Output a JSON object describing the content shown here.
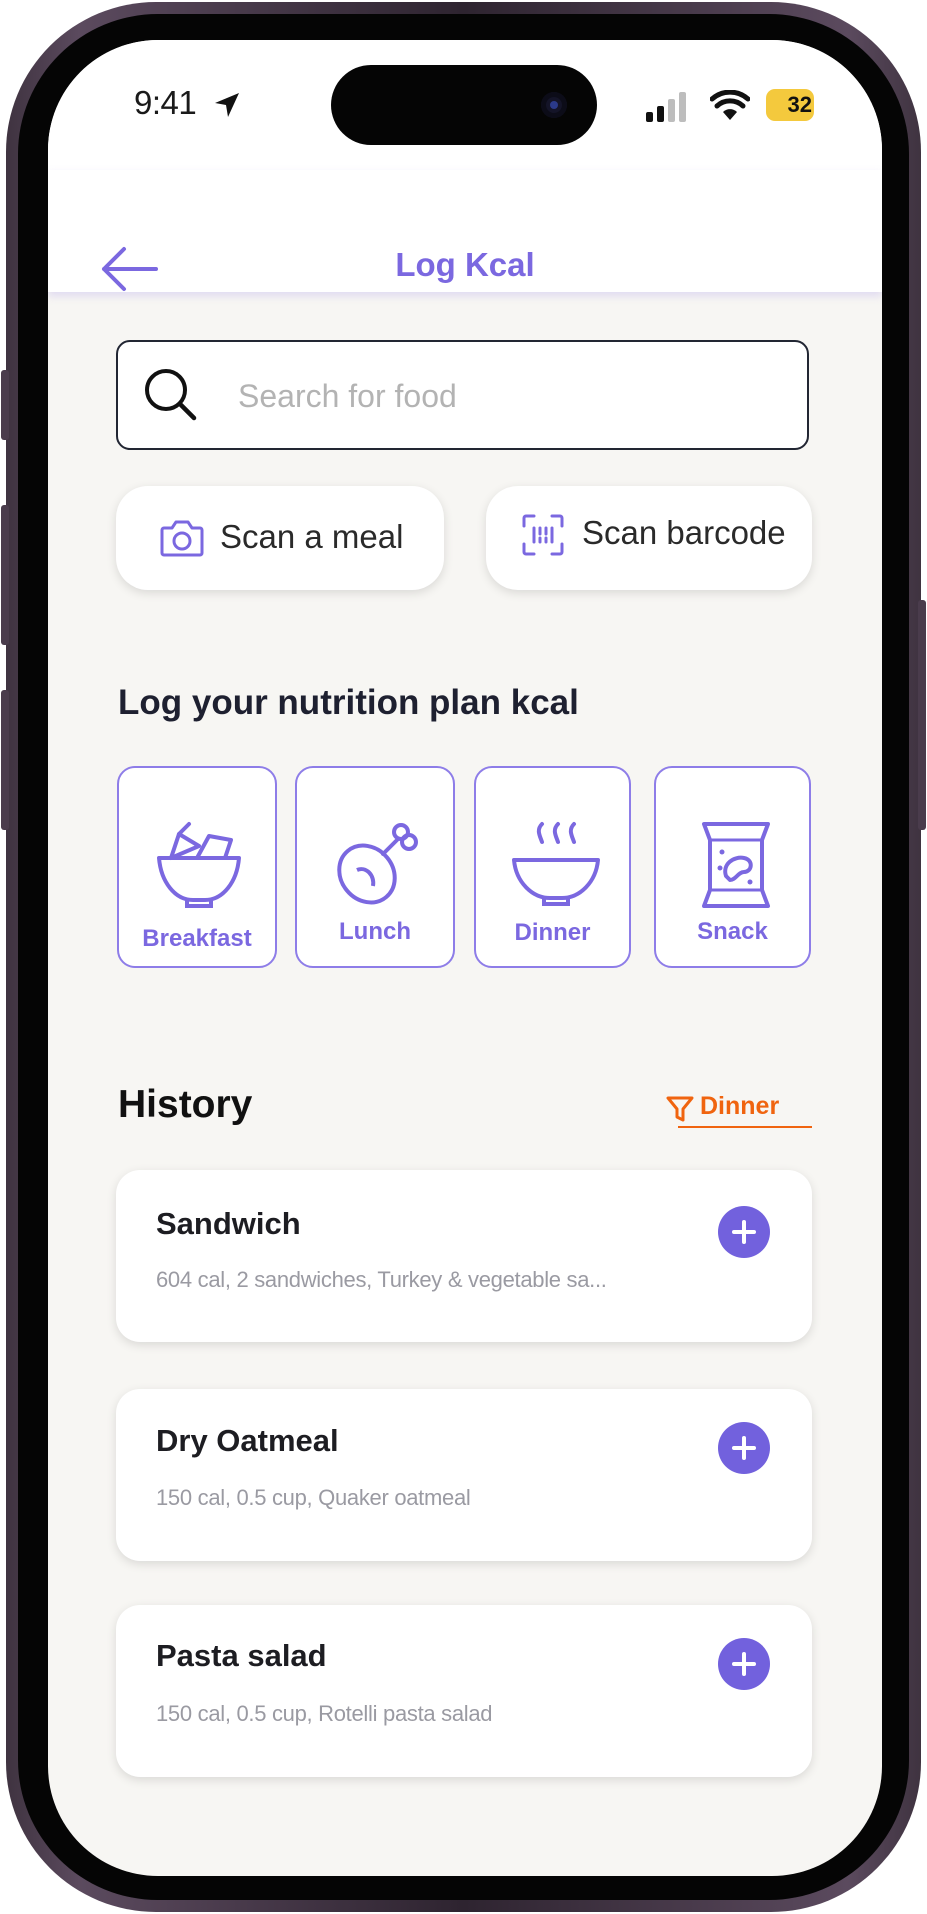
{
  "status_bar": {
    "time": "9:41",
    "battery": "32",
    "icons": [
      "location-arrow-icon",
      "cellular-signal-icon",
      "wifi-icon",
      "battery-icon"
    ]
  },
  "header": {
    "title": "Log Kcal",
    "back_icon": "arrow-left-icon"
  },
  "search": {
    "placeholder": "Search for food",
    "value": "",
    "icon": "search-icon"
  },
  "scan_actions": [
    {
      "label": "Scan a meal",
      "icon": "camera-icon"
    },
    {
      "label": "Scan barcode",
      "icon": "barcode-scan-icon"
    }
  ],
  "nutrition_plan": {
    "title": "Log your nutrition plan kcal",
    "meals": [
      {
        "label": "Breakfast",
        "icon": "salad-bowl-icon"
      },
      {
        "label": "Lunch",
        "icon": "drumstick-icon"
      },
      {
        "label": "Dinner",
        "icon": "soup-bowl-icon"
      },
      {
        "label": "Snack",
        "icon": "chips-bag-icon"
      }
    ]
  },
  "history": {
    "title": "History",
    "filter_label": "Dinner",
    "filter_icon": "filter-icon",
    "items": [
      {
        "name": "Sandwich",
        "description": "604 cal, 2 sandwiches, Turkey & vegetable sa..."
      },
      {
        "name": "Dry Oatmeal",
        "description": "150 cal, 0.5 cup, Quaker oatmeal"
      },
      {
        "name": "Pasta salad",
        "description": "150 cal, 0.5 cup, Rotelli pasta salad"
      }
    ]
  },
  "colors": {
    "accent": "#7b68e0",
    "accent_button": "#7261dd",
    "filter": "#f0640f",
    "background": "#f7f6f3"
  }
}
